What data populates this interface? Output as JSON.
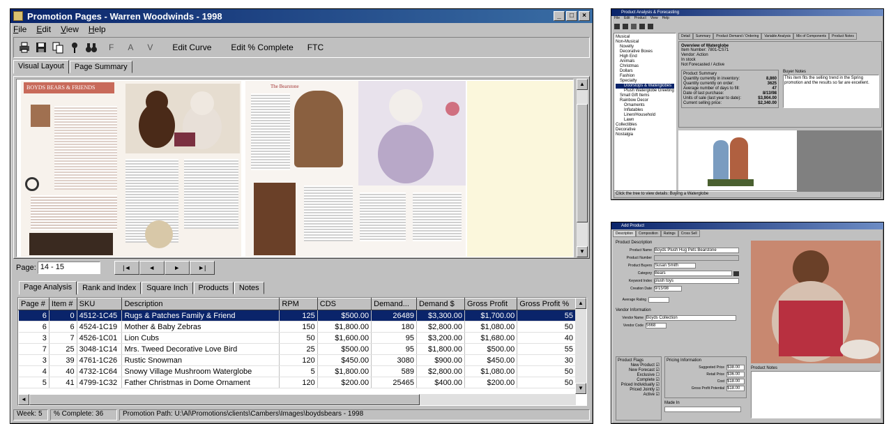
{
  "main_window": {
    "title": "Promotion Pages - Warren Woodwinds - 1998",
    "menu": [
      "File",
      "Edit",
      "View",
      "Help"
    ],
    "toolbar": {
      "icons": [
        "print-icon",
        "save-icon",
        "copy-icon",
        "pin-icon",
        "binoculars-icon"
      ],
      "letters": [
        "F",
        "A",
        "V"
      ],
      "buttons": [
        "Edit Curve",
        "Edit % Complete",
        "FTC"
      ]
    },
    "view_tabs": [
      "Visual Layout",
      "Page Summary"
    ],
    "spread": {
      "left_header": "BOYDS BEARS & FRIENDS",
      "right_header": "The Bearstone"
    },
    "page_label": "Page:",
    "page_value": "14 - 15",
    "nav_buttons": [
      "|◄",
      "◄",
      "►",
      "►|"
    ],
    "analysis_tabs": [
      "Page Analysis",
      "Rank and Index",
      "Square Inch",
      "Products",
      "Notes"
    ],
    "columns": [
      "Page #",
      "Item #",
      "SKU",
      "Description",
      "RPM",
      "CDS",
      "Demand...",
      "Demand $",
      "Gross Profit",
      "Gross Profit %"
    ],
    "rows": [
      [
        "6",
        "0",
        "4512-1C45",
        "Rugs & Patches Family & Friend",
        "125",
        "$500.00",
        "26489",
        "$3,300.00",
        "$1,700.00",
        "55"
      ],
      [
        "6",
        "6",
        "4524-1C19",
        "Mother & Baby Zebras",
        "150",
        "$1,800.00",
        "180",
        "$2,800.00",
        "$1,080.00",
        "50"
      ],
      [
        "3",
        "7",
        "4526-1C01",
        "Lion Cubs",
        "50",
        "$1,600.00",
        "95",
        "$3,200.00",
        "$1,680.00",
        "40"
      ],
      [
        "7",
        "25",
        "3048-1C14",
        "Mrs. Tweed Decorative Love Bird",
        "25",
        "$500.00",
        "95",
        "$1,800.00",
        "$500.00",
        "55"
      ],
      [
        "3",
        "39",
        "4761-1C26",
        "Rustic Snowman",
        "120",
        "$450.00",
        "3080",
        "$900.00",
        "$450.00",
        "30"
      ],
      [
        "4",
        "40",
        "4732-1C64",
        "Snowy Village Mushroom Waterglobe",
        "5",
        "$1,800.00",
        "589",
        "$2,800.00",
        "$1,080.00",
        "50"
      ],
      [
        "5",
        "41",
        "4799-1C32",
        "Father Christmas in Dome Ornament",
        "120",
        "$200.00",
        "25465",
        "$400.00",
        "$200.00",
        "50"
      ]
    ],
    "status": [
      "Week: 5",
      "% Complete: 36",
      "Promotion Path: U:\\Al\\Promotions\\clients\\Cambers\\Images\\boydsbears - 1998"
    ]
  },
  "top_right_window": {
    "title": "Product Analysis & Forecasting",
    "menu": [
      "File",
      "Edit",
      "Product",
      "View",
      "Help"
    ],
    "tabs": [
      "Detail",
      "Summary",
      "Product Demand / Ordering",
      "Variable Analysis",
      "Mix of Components",
      "Product Notes"
    ],
    "tree": [
      "Musical",
      "Non-Musical",
      "Novelty",
      "Decorative Boxes",
      "High End",
      "Animals",
      "Christmas",
      "Dollars",
      "Fashion",
      "Specialty",
      "Doorstops & Waterglobes",
      "Plush Waterglobe Greeting",
      "Small Gift Items",
      "Rainbow Decor",
      "Ornaments",
      "Inflatables",
      "Linen/Household",
      "Lawn",
      "Collectibles",
      "Decorative",
      "Nostalgia"
    ],
    "summary_title": "Overview of Waterglobe",
    "summary_lines": [
      "Item Number: 7801-CS71",
      "Vendor: Action",
      "In stock",
      "Not Forecasted / Active"
    ],
    "sales_summary_label": "Product Summary",
    "sales_rows": [
      [
        "Quantity currently in inventory:",
        "8,860"
      ],
      [
        "Quantity currently on order:",
        "3625"
      ],
      [
        "Average number of days to fill:",
        "47"
      ],
      [
        "Date of last purchase:",
        "8/13/98"
      ],
      [
        "Units of sale (last year to date):",
        "$3,904.00"
      ],
      [
        "Current selling price:",
        "$2,340.00"
      ]
    ],
    "notes_label": "Buyer Notes",
    "notes_text": "This item fits the selling trend in the Spring promotion and the results so far are excellent.",
    "status": "Click the tree to view details: Buying a Waterglobe"
  },
  "bottom_right_window": {
    "title": "Add Product",
    "tabs": [
      "Description",
      "Composition",
      "Ratings",
      "Cross Sell"
    ],
    "section": "Product Description",
    "fields": [
      [
        "Product Name",
        "Boyds Plush Hug Pets Bearstone"
      ],
      [
        "Product Number",
        ""
      ],
      [
        "Product Buyers",
        "Susan Smith"
      ],
      [
        "Category",
        "Bears"
      ],
      [
        "Keyword Index",
        "plush toys"
      ],
      [
        "Creation Date",
        "9/15/98"
      ]
    ],
    "avg_rating_label": "Average Rating",
    "vendor_section": "Vendor Information",
    "vendor_fields": [
      [
        "Vendor Name",
        "Boyds Collection"
      ],
      [
        "Vendor Code",
        "5668"
      ]
    ],
    "product_flags_label": "Product Flags",
    "flags": [
      "New Product",
      "New Forecast",
      "Exclusive",
      "Complete",
      "Priced Individually",
      "Priced Jointly",
      "Active"
    ],
    "pricing_label": "Pricing Information",
    "pricing_fields": [
      [
        "Suggested Price",
        "$38.00"
      ],
      [
        "Retail Price",
        "$36.00"
      ],
      [
        "Cost",
        "$18.00"
      ],
      [
        "Gross Profit Potential",
        "$18.00"
      ]
    ],
    "made_in_label": "Made In",
    "notes_label": "Product Notes"
  }
}
